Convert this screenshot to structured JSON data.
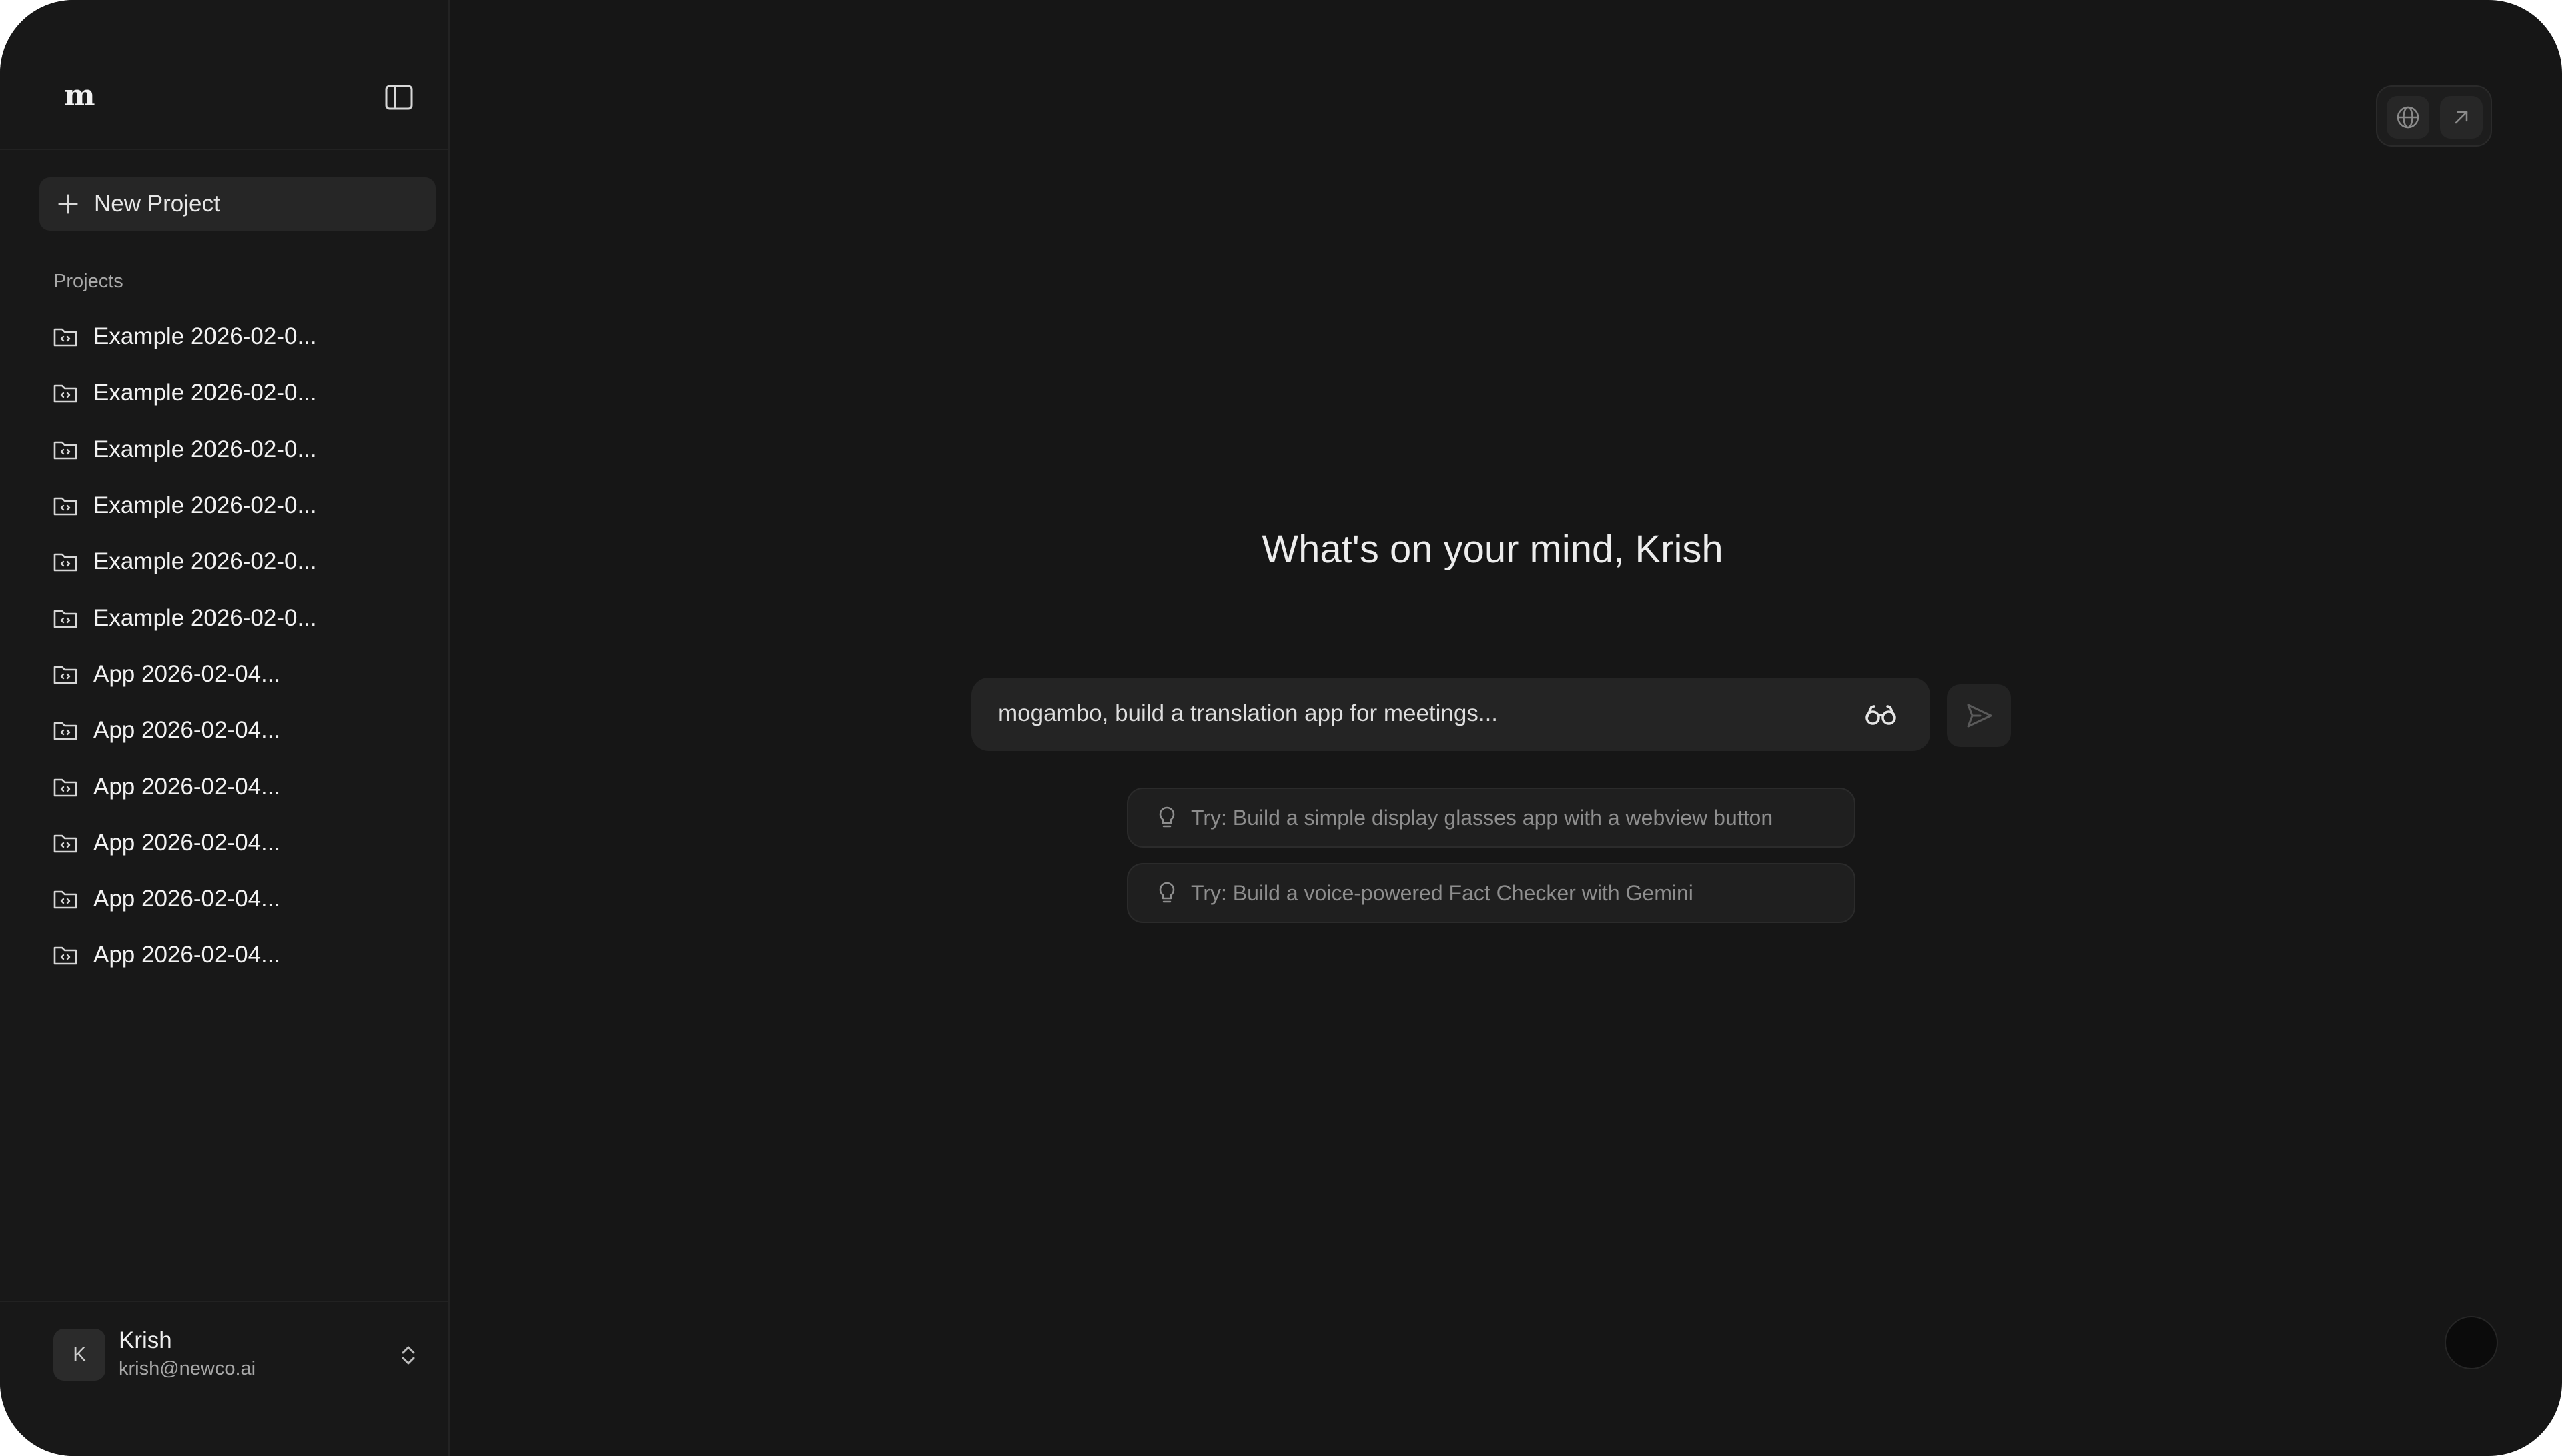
{
  "sidebar": {
    "logo": "m",
    "new_project_label": "New Project",
    "section_title": "Projects",
    "projects": [
      {
        "name": "Example 2026-02-0..."
      },
      {
        "name": "Example 2026-02-0..."
      },
      {
        "name": "Example 2026-02-0..."
      },
      {
        "name": "Example 2026-02-0..."
      },
      {
        "name": "Example 2026-02-0..."
      },
      {
        "name": "Example 2026-02-0..."
      },
      {
        "name": "App 2026-02-04..."
      },
      {
        "name": "App 2026-02-04..."
      },
      {
        "name": "App 2026-02-04..."
      },
      {
        "name": "App 2026-02-04..."
      },
      {
        "name": "App 2026-02-04..."
      },
      {
        "name": "App 2026-02-04..."
      }
    ],
    "user": {
      "initial": "K",
      "name": "Krish",
      "email": "krish@newco.ai"
    }
  },
  "main": {
    "headline": "What's on your mind, Krish",
    "prompt": {
      "placeholder": "mogambo, build a translation app for meetings..."
    },
    "suggestions": [
      {
        "text": "Try: Build a simple display glasses app with a webview button"
      },
      {
        "text": "Try: Build a voice-powered Fact Checker with Gemini"
      }
    ]
  },
  "icons": {
    "toggle": "sidebar-toggle-icon",
    "plus": "plus-icon",
    "project": "folder-code-icon",
    "chevrons": "chevrons-up-down-icon",
    "globe": "globe-icon",
    "external": "arrow-up-right-icon",
    "glasses": "glasses-icon",
    "send": "send-icon",
    "bulb": "lightbulb-icon"
  },
  "colors": {
    "background": "#161616",
    "sidebar": "#181818",
    "input": "#242424",
    "text": "#ededed",
    "muted": "#8e8e8e"
  }
}
